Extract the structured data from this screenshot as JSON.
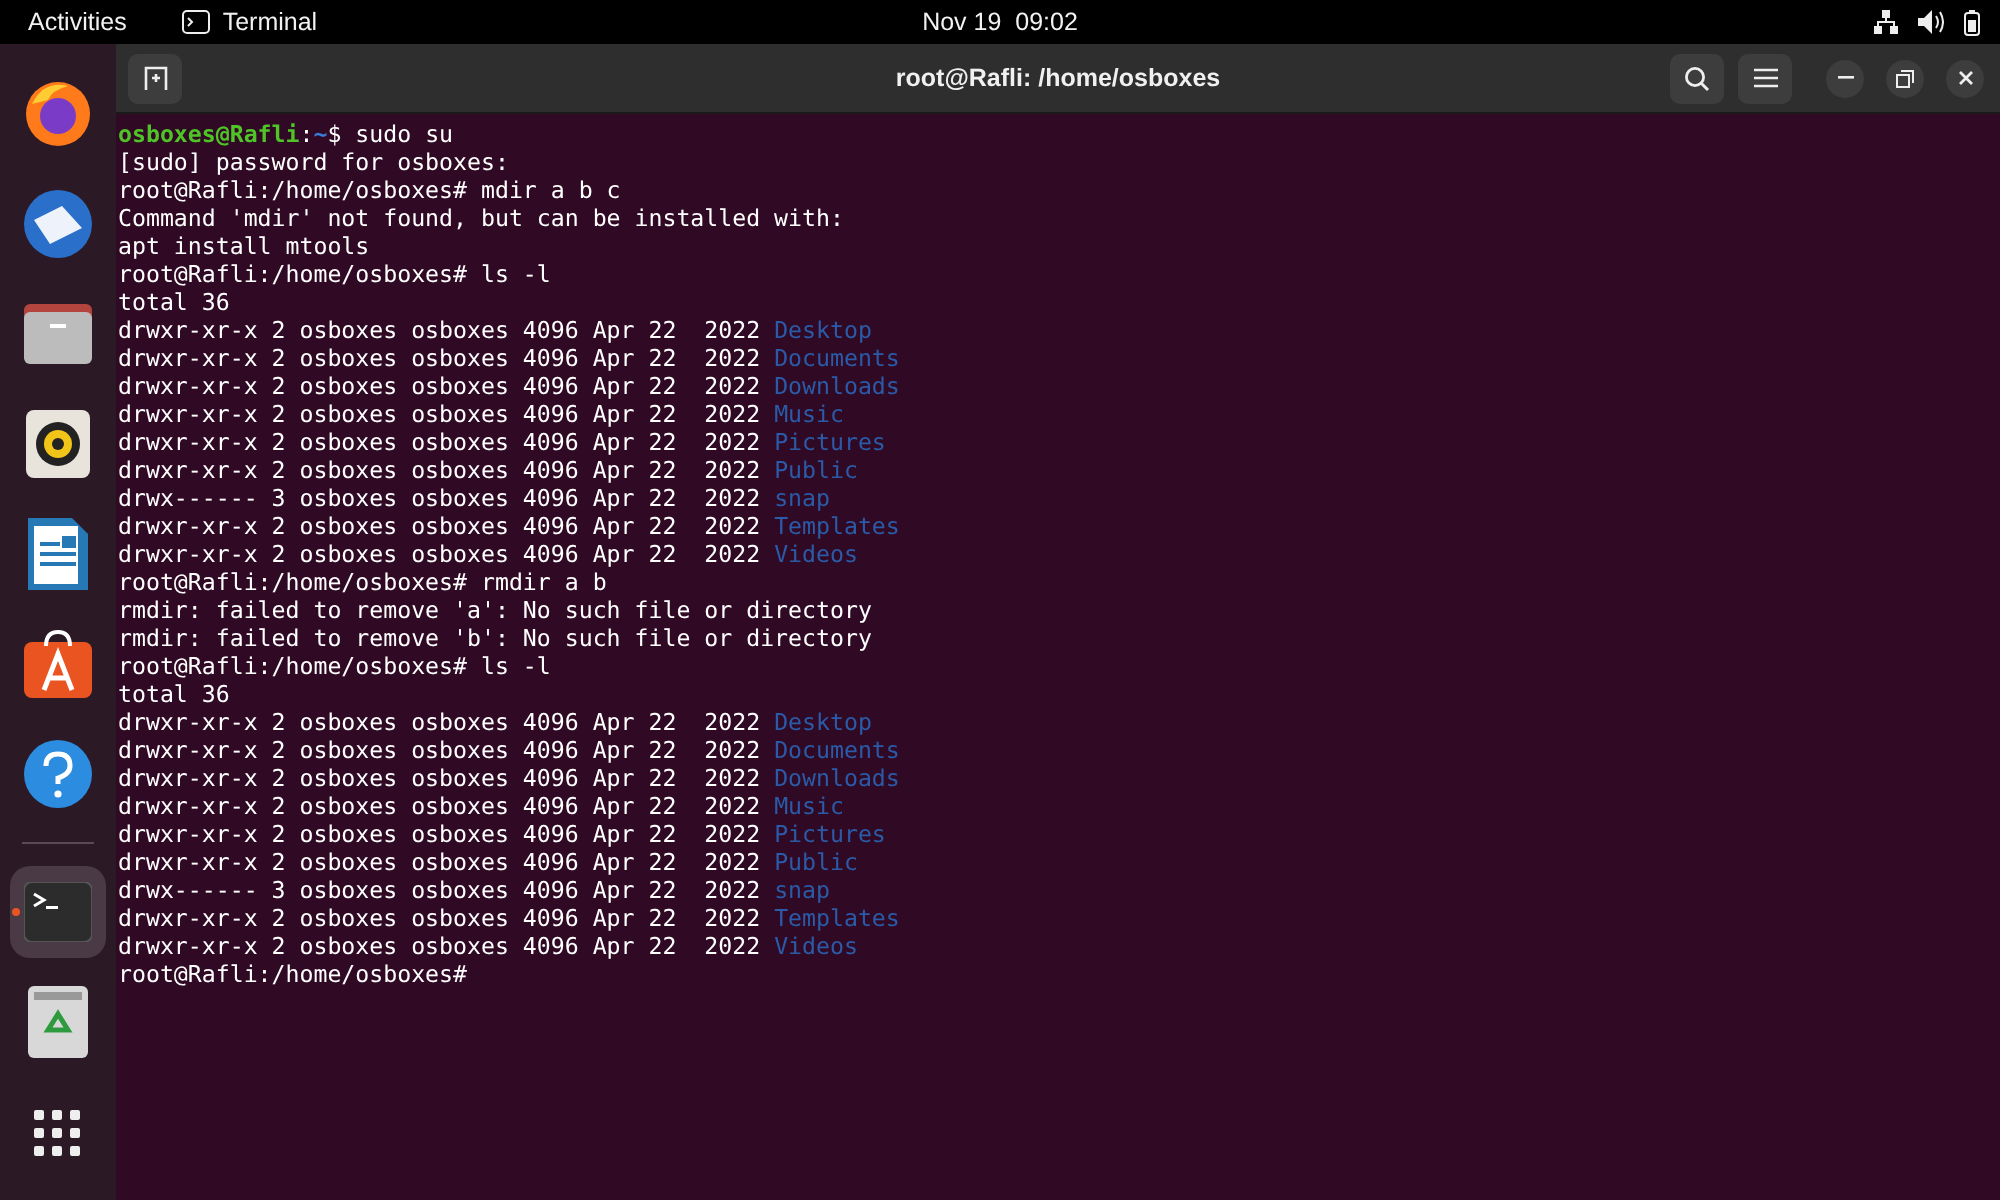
{
  "top_bar": {
    "activities": "Activities",
    "app_name": "Terminal",
    "clock": "Nov 19  09:02"
  },
  "dock": [
    {
      "kind": "browser",
      "selected": false,
      "running": false
    },
    {
      "kind": "mail",
      "selected": false,
      "running": false
    },
    {
      "kind": "files",
      "selected": false,
      "running": false
    },
    {
      "kind": "music",
      "selected": false,
      "running": false
    },
    {
      "kind": "writer",
      "selected": false,
      "running": false
    },
    {
      "kind": "store",
      "selected": false,
      "running": false
    },
    {
      "kind": "help",
      "selected": false,
      "running": false
    },
    {
      "kind": "separator"
    },
    {
      "kind": "terminal",
      "selected": true,
      "running": true
    },
    {
      "kind": "trash",
      "selected": false,
      "running": false
    }
  ],
  "window": {
    "title": "root@Rafli: /home/osboxes"
  },
  "terminal": {
    "lines": [
      {
        "kind": "prompt",
        "user": "osboxes@Rafli",
        "sep": ":",
        "path": "~",
        "command": "$ sudo su"
      },
      {
        "kind": "output",
        "text": "[sudo] password for osboxes:"
      },
      {
        "kind": "output",
        "text": "root@Rafli:/home/osboxes# mdir a b c"
      },
      {
        "kind": "output",
        "text": "Command 'mdir' not found, but can be installed with:"
      },
      {
        "kind": "output",
        "text": "apt install mtools"
      },
      {
        "kind": "output",
        "text": "root@Rafli:/home/osboxes# ls -l"
      },
      {
        "kind": "output",
        "text": "total 36"
      },
      {
        "kind": "listing",
        "text": "drwxr-xr-x 2 osboxes osboxes 4096 Apr 22  2022",
        "name": "Desktop"
      },
      {
        "kind": "listing",
        "text": "drwxr-xr-x 2 osboxes osboxes 4096 Apr 22  2022",
        "name": "Documents"
      },
      {
        "kind": "listing",
        "text": "drwxr-xr-x 2 osboxes osboxes 4096 Apr 22  2022",
        "name": "Downloads"
      },
      {
        "kind": "listing",
        "text": "drwxr-xr-x 2 osboxes osboxes 4096 Apr 22  2022",
        "name": "Music"
      },
      {
        "kind": "listing",
        "text": "drwxr-xr-x 2 osboxes osboxes 4096 Apr 22  2022",
        "name": "Pictures"
      },
      {
        "kind": "listing",
        "text": "drwxr-xr-x 2 osboxes osboxes 4096 Apr 22  2022",
        "name": "Public"
      },
      {
        "kind": "listing",
        "text": "drwx------ 3 osboxes osboxes 4096 Apr 22  2022",
        "name": "snap"
      },
      {
        "kind": "listing",
        "text": "drwxr-xr-x 2 osboxes osboxes 4096 Apr 22  2022",
        "name": "Templates"
      },
      {
        "kind": "listing",
        "text": "drwxr-xr-x 2 osboxes osboxes 4096 Apr 22  2022",
        "name": "Videos"
      },
      {
        "kind": "output",
        "text": "root@Rafli:/home/osboxes# rmdir a b"
      },
      {
        "kind": "output",
        "text": "rmdir: failed to remove 'a': No such file or directory"
      },
      {
        "kind": "output",
        "text": "rmdir: failed to remove 'b': No such file or directory"
      },
      {
        "kind": "output",
        "text": "root@Rafli:/home/osboxes# ls -l"
      },
      {
        "kind": "output",
        "text": "total 36"
      },
      {
        "kind": "listing",
        "text": "drwxr-xr-x 2 osboxes osboxes 4096 Apr 22  2022",
        "name": "Desktop"
      },
      {
        "kind": "listing",
        "text": "drwxr-xr-x 2 osboxes osboxes 4096 Apr 22  2022",
        "name": "Documents"
      },
      {
        "kind": "listing",
        "text": "drwxr-xr-x 2 osboxes osboxes 4096 Apr 22  2022",
        "name": "Downloads"
      },
      {
        "kind": "listing",
        "text": "drwxr-xr-x 2 osboxes osboxes 4096 Apr 22  2022",
        "name": "Music"
      },
      {
        "kind": "listing",
        "text": "drwxr-xr-x 2 osboxes osboxes 4096 Apr 22  2022",
        "name": "Pictures"
      },
      {
        "kind": "listing",
        "text": "drwxr-xr-x 2 osboxes osboxes 4096 Apr 22  2022",
        "name": "Public"
      },
      {
        "kind": "listing",
        "text": "drwx------ 3 osboxes osboxes 4096 Apr 22  2022",
        "name": "snap"
      },
      {
        "kind": "listing",
        "text": "drwxr-xr-x 2 osboxes osboxes 4096 Apr 22  2022",
        "name": "Templates"
      },
      {
        "kind": "listing",
        "text": "drwxr-xr-x 2 osboxes osboxes 4096 Apr 22  2022",
        "name": "Videos"
      },
      {
        "kind": "output",
        "text": "root@Rafli:/home/osboxes#"
      }
    ]
  }
}
